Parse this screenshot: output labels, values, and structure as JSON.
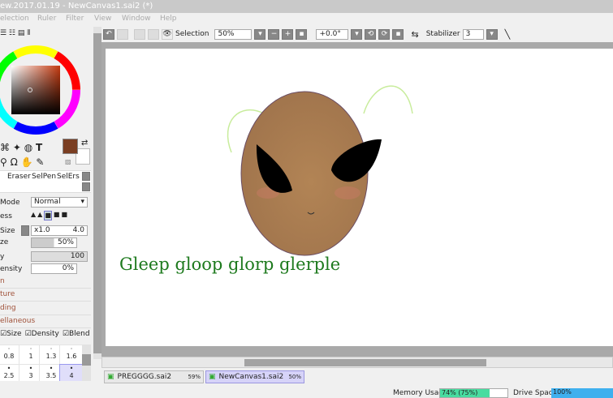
{
  "window": {
    "title": "ew.2017.01.19 - NewCanvas1.sai2 (*)"
  },
  "menu": [
    "election",
    "Ruler",
    "Filter",
    "View",
    "Window",
    "Help"
  ],
  "toolbar": {
    "selection_label": "Selection",
    "zoom": "50%",
    "rotation": "+0.0°",
    "stabilizer_label": "Stabilizer",
    "stabilizer_value": "3"
  },
  "tools": {
    "brushes": [
      "Eraser",
      "SelPen",
      "SelErs"
    ],
    "primary_color": "#7a3e22"
  },
  "brush": {
    "mode_label": "Mode",
    "mode_value": "Normal",
    "hardness_label": "ess",
    "size_label": "Size",
    "size_mult": "x1.0",
    "size_value": "4.0",
    "min_size_label": "ze",
    "min_size_value": "50%",
    "density_label": "y",
    "density_value": "100",
    "min_density_label": "ensity",
    "min_density_value": "0%",
    "sections": [
      "n",
      "ture",
      "ding",
      "ellaneous"
    ],
    "checks": [
      "Size",
      "Density",
      "Blend"
    ],
    "size_presets": [
      "0.8",
      "1",
      "1.3",
      "1.6",
      "2.5",
      "3",
      "3.5",
      "4"
    ]
  },
  "canvas": {
    "text": "Gleep gloop glorp glerple",
    "text_color": "#1e7a1e"
  },
  "tabs": [
    {
      "name": "PREGGGG.sai2",
      "zoom": "59%"
    },
    {
      "name": "NewCanvas1.sai2",
      "zoom": "50%"
    }
  ],
  "status": {
    "memory_label": "Memory Usage",
    "memory_value": "74% (75%)",
    "memory_fraction": 0.74,
    "drive_label": "Drive Space",
    "drive_value": "100%",
    "drive_fraction": 1.0
  }
}
